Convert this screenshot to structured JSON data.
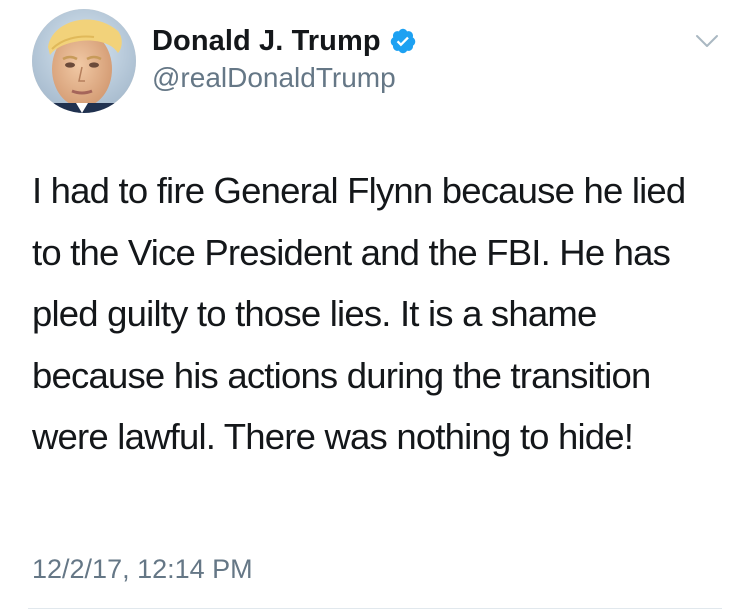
{
  "author": {
    "display_name": "Donald J. Trump",
    "handle": "@realDonaldTrump",
    "verified": true
  },
  "tweet": {
    "text": "I had to fire General Flynn because he lied to the Vice President and the FBI. He has pled guilty to those lies. It is a shame because his actions during the transition were lawful. There was nothing to hide!",
    "timestamp": "12/2/17, 12:14 PM"
  },
  "icons": {
    "avatar": "profile-photo",
    "verified": "verified-badge-icon",
    "more": "chevron-down-icon"
  },
  "colors": {
    "text_primary": "#14171a",
    "text_secondary": "#657786",
    "verified_blue": "#1da1f2",
    "divider": "#e1e8ed"
  }
}
